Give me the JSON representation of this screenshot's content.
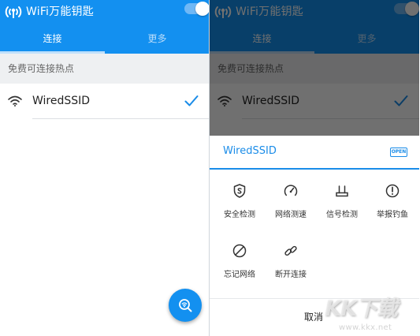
{
  "app": {
    "title": "WiFi万能钥匙",
    "toggle_on": true
  },
  "tabs": [
    {
      "label": "连接",
      "active": true
    },
    {
      "label": "更多",
      "active": false
    }
  ],
  "section": {
    "label": "免费可连接热点"
  },
  "networks": [
    {
      "ssid": "WiredSSID",
      "connected": true
    }
  ],
  "sheet": {
    "title": "WiredSSID",
    "badge": "OPEN",
    "actions": [
      {
        "label": "安全检测",
        "icon": "shield-s-icon"
      },
      {
        "label": "网络测速",
        "icon": "speedometer-icon"
      },
      {
        "label": "信号检测",
        "icon": "router-signal-icon"
      },
      {
        "label": "举报钓鱼",
        "icon": "alert-circle-icon"
      },
      {
        "label": "忘记网络",
        "icon": "forbidden-icon"
      },
      {
        "label": "断开连接",
        "icon": "broken-link-icon"
      }
    ],
    "cancel": "取消"
  },
  "watermark": {
    "logo": "KK下载",
    "url": "www.kkx.net"
  },
  "colors": {
    "primary": "#1390f0",
    "accent": "#1a8ce8",
    "section_bg": "#eef0f2",
    "overlay": "rgba(0,0,0,0.56)"
  }
}
